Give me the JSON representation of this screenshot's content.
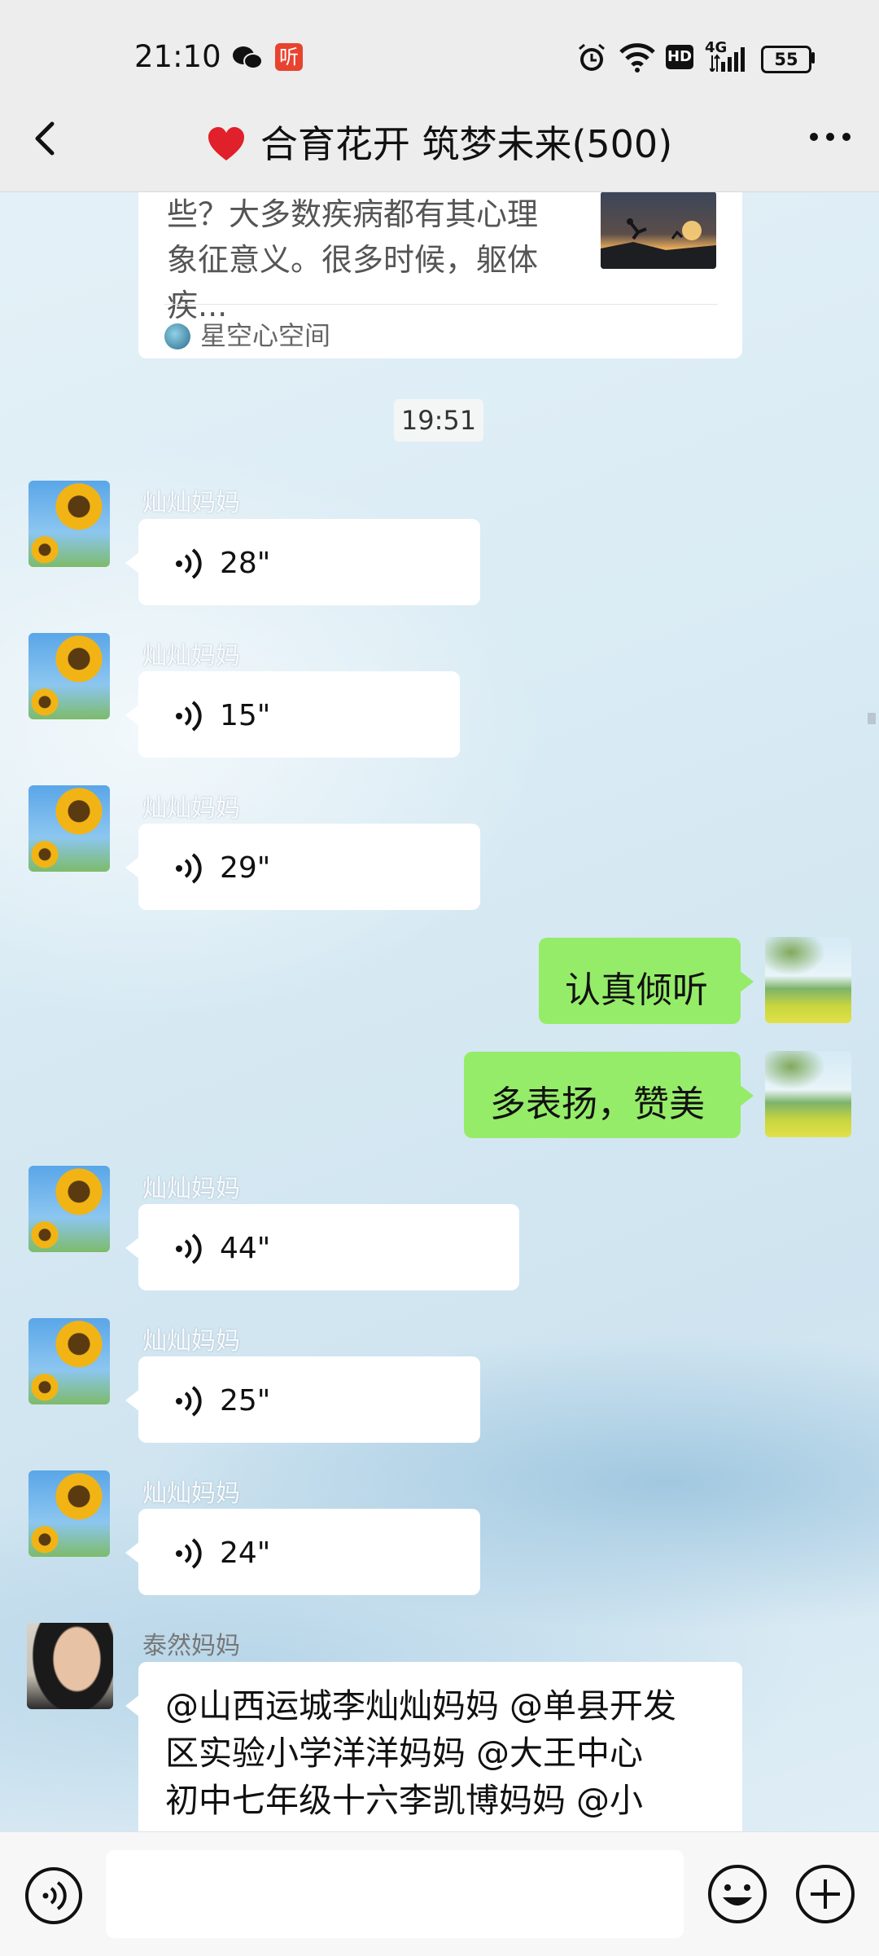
{
  "status_bar": {
    "time": "21:10",
    "network": "4G",
    "hd": "HD",
    "battery": "55",
    "app_badge": "听"
  },
  "chat": {
    "title_icon": "heart-icon",
    "title": "合育花开 筑梦未来(500)"
  },
  "article_card": {
    "excerpt": "些？大多数疾病都有其心理象征意义。很多时候，躯体疾...",
    "source": "星空心空间"
  },
  "timestamp": "19:51",
  "messages": [
    {
      "sender": "灿灿妈妈",
      "type": "voice",
      "duration": "28\""
    },
    {
      "sender": "灿灿妈妈",
      "type": "voice",
      "duration": "15\""
    },
    {
      "sender": "灿灿妈妈",
      "type": "voice",
      "duration": "29\""
    },
    {
      "sender": "me",
      "type": "text",
      "text": "认真倾听"
    },
    {
      "sender": "me",
      "type": "text",
      "text": "多表扬，赞美"
    },
    {
      "sender": "灿灿妈妈",
      "type": "voice",
      "duration": "44\""
    },
    {
      "sender": "灿灿妈妈",
      "type": "voice",
      "duration": "25\""
    },
    {
      "sender": "灿灿妈妈",
      "type": "voice",
      "duration": "24\""
    },
    {
      "sender": "泰然妈妈",
      "type": "text",
      "text": "@山西运城李灿灿妈妈 @单县开发\n区实验小学洋洋妈妈 @大王中心\n初中七年级十六李凯博妈妈 @小"
    }
  ],
  "colors": {
    "bar_bg": "#ededed",
    "sent_bubble": "#95ec69",
    "received_bubble": "#ffffff",
    "heart": "#e0202a"
  }
}
